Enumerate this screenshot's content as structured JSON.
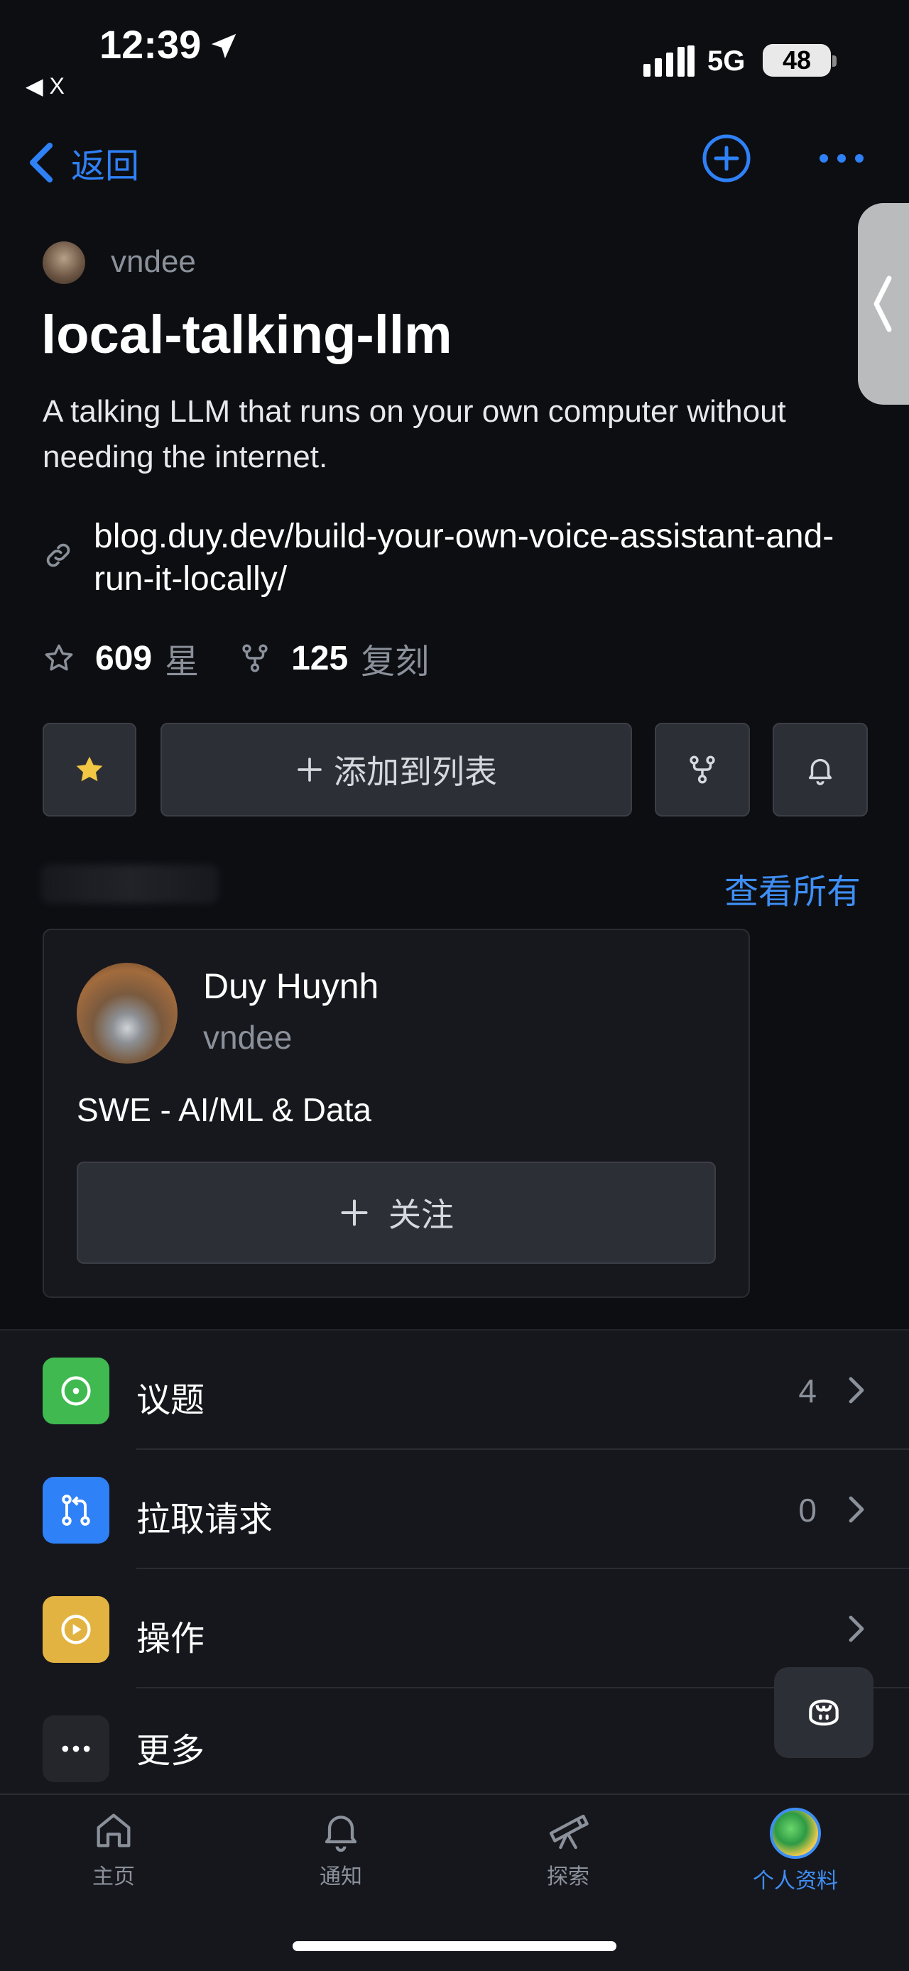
{
  "status_bar": {
    "time": "12:39",
    "back_app": "◀ X",
    "network": "5G",
    "battery": "48"
  },
  "nav": {
    "back_label": "返回"
  },
  "repo": {
    "owner": "vndee",
    "name": "local-talking-llm",
    "description": "A talking LLM that runs on your own computer without needing the internet.",
    "link": "blog.duy.dev/build-your-own-voice-assistant-and-run-it-locally/",
    "stars": "609",
    "stars_label": "星",
    "forks": "125",
    "forks_label": "复刻"
  },
  "actions": {
    "add_to_list": "添加到列表"
  },
  "contributors": {
    "view_all": "查看所有",
    "card": {
      "name": "Duy Huynh",
      "username": "vndee",
      "bio": "SWE - AI/ML & Data",
      "follow_label": "关注"
    }
  },
  "menu": [
    {
      "label": "议题",
      "count": "4",
      "color": "#3fb950"
    },
    {
      "label": "拉取请求",
      "count": "0",
      "color": "#2f81f7"
    },
    {
      "label": "操作",
      "count": "",
      "color": "#e3b341"
    },
    {
      "label": "更多",
      "count": "",
      "color": "#2d2f36"
    }
  ],
  "tabs": [
    {
      "label": "主页",
      "icon": "home-icon"
    },
    {
      "label": "通知",
      "icon": "bell-icon"
    },
    {
      "label": "探索",
      "icon": "telescope-icon"
    },
    {
      "label": "个人资料",
      "icon": "avatar"
    }
  ],
  "colors": {
    "accent": "#3e8ef4",
    "star": "#f2c744",
    "background": "#0d0e12"
  }
}
